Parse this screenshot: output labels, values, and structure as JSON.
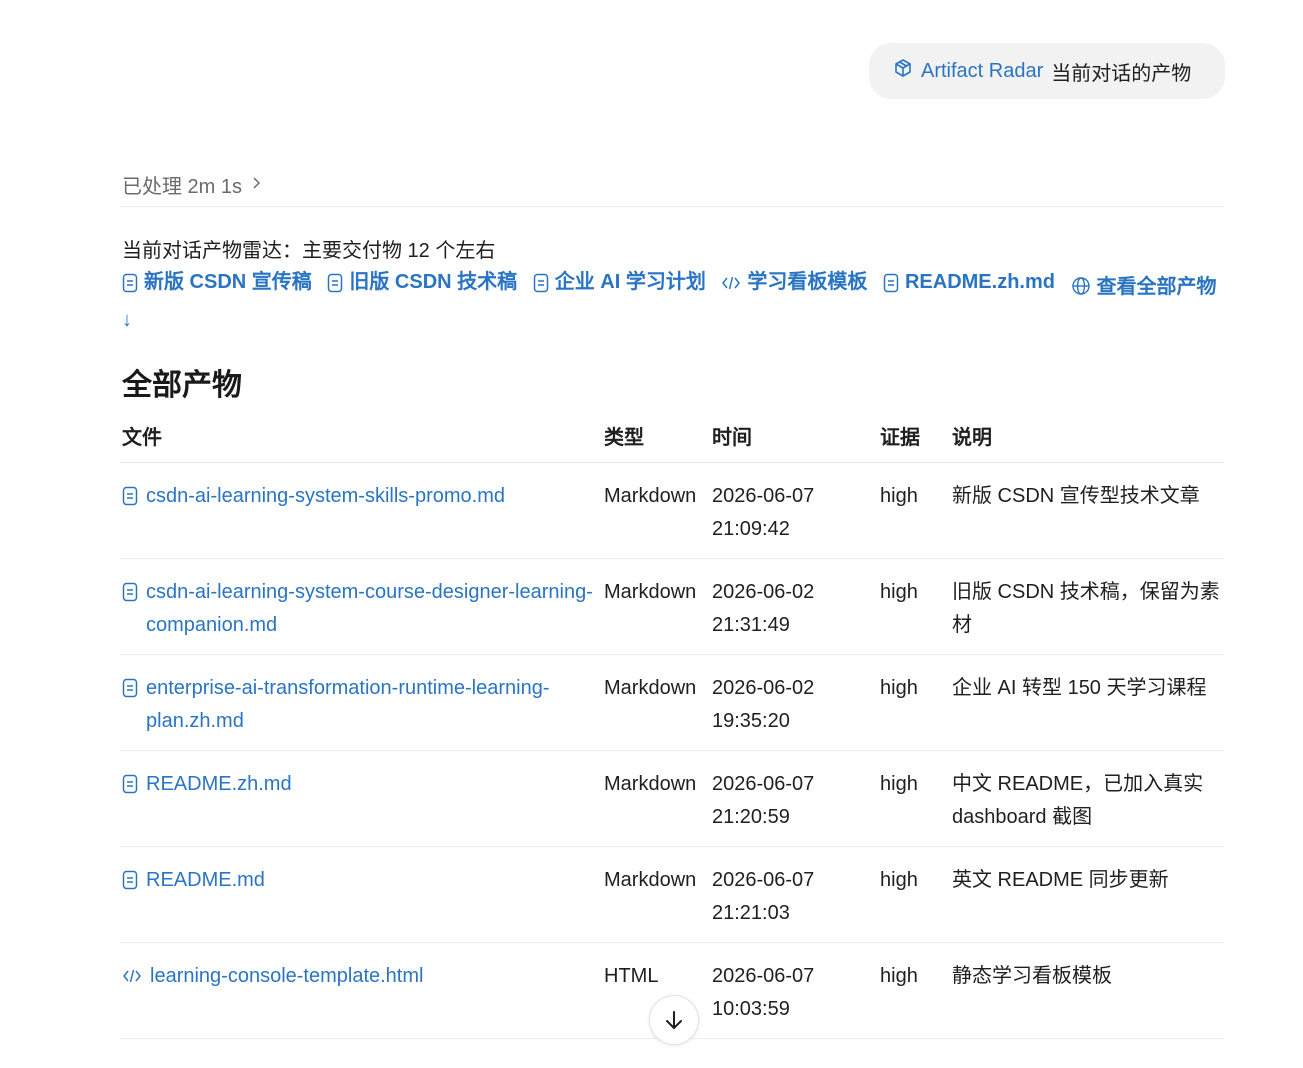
{
  "radar_pill": {
    "title": "Artifact Radar",
    "subtitle": "当前对话的产物",
    "icon": "cube-icon"
  },
  "processed": {
    "text": "已处理 2m 1s",
    "icon": "chevron-right-icon"
  },
  "summary": "当前对话产物雷达：主要交付物 12 个左右",
  "quick_links": [
    {
      "label": "新版 CSDN 宣传稿",
      "icon": "document-icon"
    },
    {
      "label": "旧版 CSDN 技术稿",
      "icon": "document-icon"
    },
    {
      "label": "企业 AI 学习计划",
      "icon": "document-icon"
    },
    {
      "label": "学习看板模板",
      "icon": "code-icon"
    },
    {
      "label": "README.zh.md",
      "icon": "document-icon"
    },
    {
      "label": "查看全部产物 ↓",
      "icon": "globe-icon"
    }
  ],
  "section_title": "全部产物",
  "table": {
    "headers": {
      "file": "文件",
      "type": "类型",
      "time": "时间",
      "evidence": "证据",
      "desc": "说明"
    },
    "rows": [
      {
        "file": "csdn-ai-learning-system-skills-promo.md",
        "icon": "document-icon",
        "type": "Markdown",
        "date": "2026-06-07",
        "clock": "21:09:42",
        "evidence": "high",
        "desc": "新版 CSDN 宣传型技术文章"
      },
      {
        "file": "csdn-ai-learning-system-course-designer-learning-companion.md",
        "icon": "document-icon",
        "type": "Markdown",
        "date": "2026-06-02",
        "clock": "21:31:49",
        "evidence": "high",
        "desc": "旧版 CSDN 技术稿，保留为素材"
      },
      {
        "file": "enterprise-ai-transformation-runtime-learning-plan.zh.md",
        "icon": "document-icon",
        "type": "Markdown",
        "date": "2026-06-02",
        "clock": "19:35:20",
        "evidence": "high",
        "desc": "企业 AI 转型 150 天学习课程"
      },
      {
        "file": "README.zh.md",
        "icon": "document-icon",
        "type": "Markdown",
        "date": "2026-06-07",
        "clock": "21:20:59",
        "evidence": "high",
        "desc": "中文 README，已加入真实 dashboard 截图"
      },
      {
        "file": "README.md",
        "icon": "document-icon",
        "type": "Markdown",
        "date": "2026-06-07",
        "clock": "21:21:03",
        "evidence": "high",
        "desc": "英文 README 同步更新"
      },
      {
        "file": "learning-console-template.html",
        "icon": "code-icon",
        "type": "HTML",
        "date": "2026-06-07",
        "clock": "10:03:59",
        "evidence": "high",
        "desc": "静态学习看板模板"
      }
    ]
  },
  "scroll_button": {
    "icon": "arrow-down-icon"
  },
  "colors": {
    "link": "#2a74c4",
    "text": "#1f1f1f",
    "muted": "#6b6b6b",
    "pill_bg": "#f2f2f2"
  }
}
